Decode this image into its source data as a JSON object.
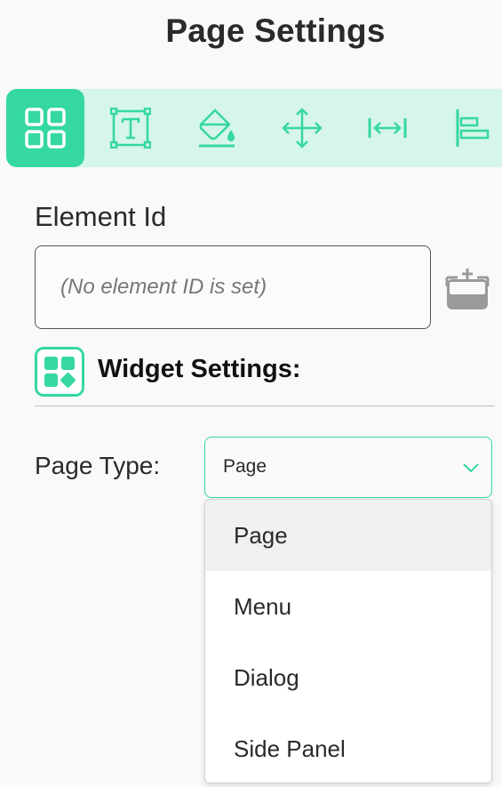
{
  "header": {
    "title": "Page Settings"
  },
  "toolbar": {
    "tools": [
      {
        "name": "grid-layout-icon",
        "active": true
      },
      {
        "name": "text-box-icon",
        "active": false
      },
      {
        "name": "paint-bucket-icon",
        "active": false
      },
      {
        "name": "move-arrows-icon",
        "active": false
      },
      {
        "name": "width-icon",
        "active": false
      },
      {
        "name": "align-left-icon",
        "active": false
      }
    ]
  },
  "element_id": {
    "label": "Element Id",
    "value": "",
    "placeholder": "(No element ID is set)",
    "add_button_icon": "add-id-icon"
  },
  "widget_settings": {
    "label": "Widget Settings:",
    "icon": "widget-icon"
  },
  "page_type": {
    "label": "Page Type:",
    "selected": "Page",
    "options": [
      "Page",
      "Menu",
      "Dialog",
      "Side Panel"
    ]
  },
  "colors": {
    "accent": "#35d8a0",
    "toolbar_bg": "#d5f6e8",
    "background": "#f9f9f9",
    "selected_option_bg": "#f0f0f0"
  }
}
